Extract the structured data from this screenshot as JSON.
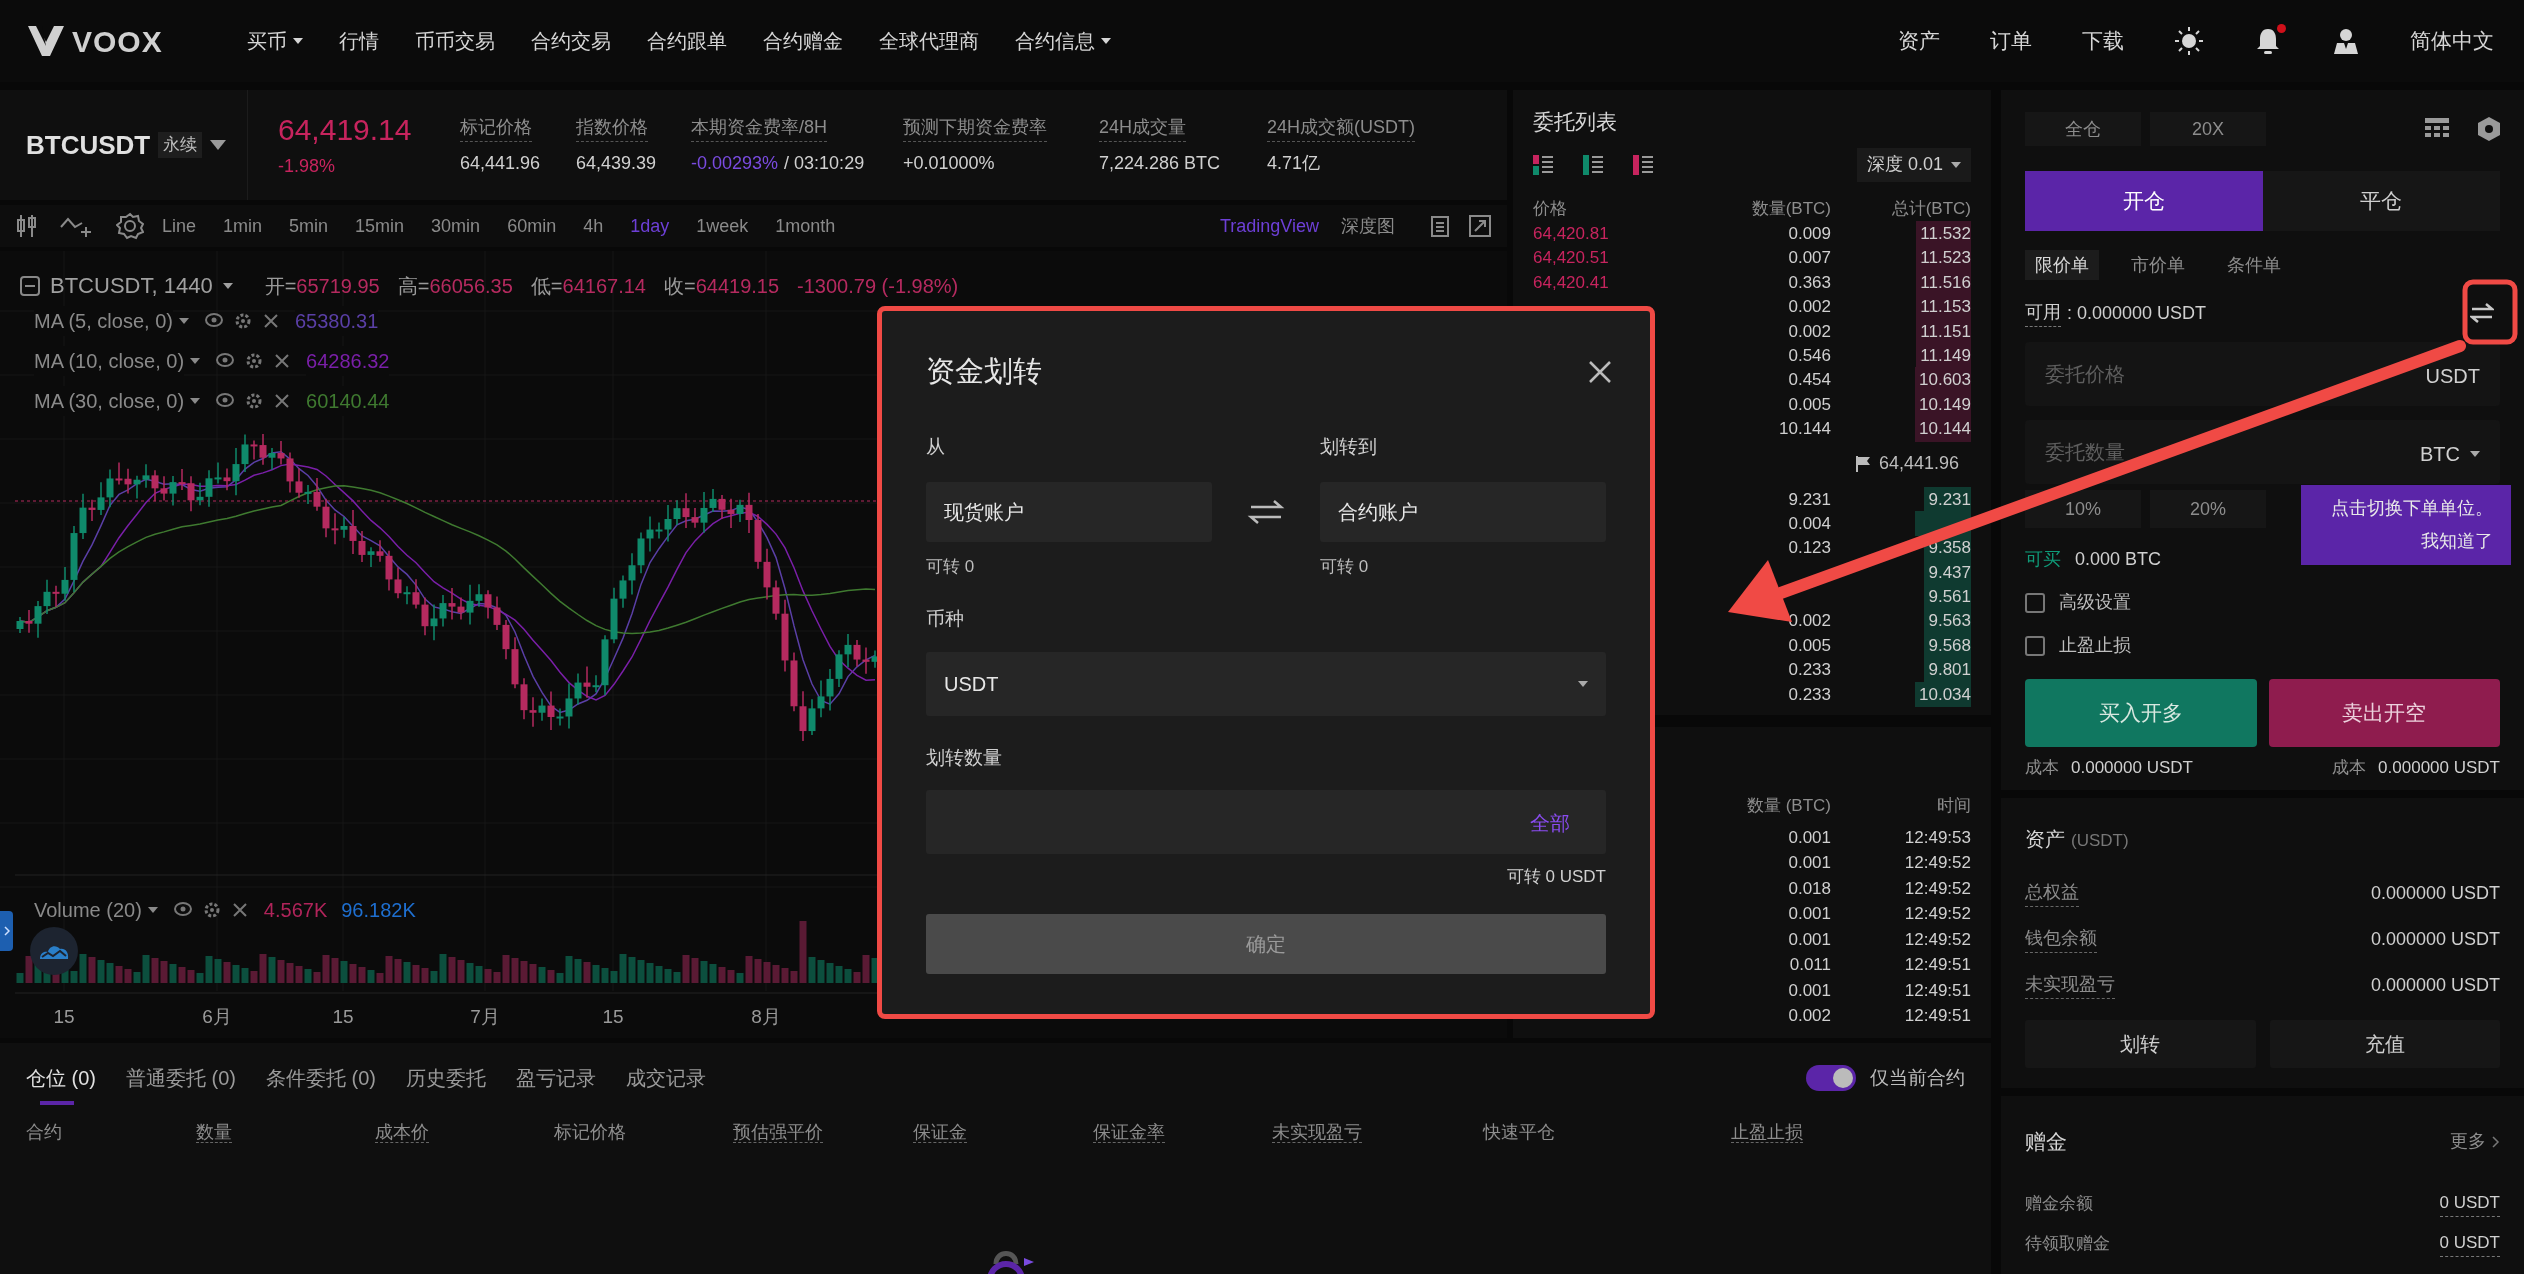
{
  "nav": {
    "logo": "VOOX",
    "items": [
      {
        "label": "买币",
        "dropdown": true
      },
      {
        "label": "行情",
        "dropdown": false
      },
      {
        "label": "币币交易",
        "dropdown": false
      },
      {
        "label": "合约交易",
        "dropdown": false
      },
      {
        "label": "合约跟单",
        "dropdown": false
      },
      {
        "label": "合约赠金",
        "dropdown": false
      },
      {
        "label": "全球代理商",
        "dropdown": false
      },
      {
        "label": "合约信息",
        "dropdown": true
      }
    ],
    "links": [
      "资产",
      "订单",
      "下载"
    ],
    "unread_notifications": true,
    "language": "简体中文"
  },
  "ticker": {
    "symbol": "BTCUSDT",
    "tag": "永续",
    "price": "64,419.14",
    "change": "-1.98%",
    "stats": [
      {
        "label": "标记价格",
        "value": "64,441.96",
        "highlight": false
      },
      {
        "label": "指数价格",
        "value": "64,439.39",
        "highlight": false
      },
      {
        "label": "本期资金费率/8H",
        "value": "-0.00293%",
        "countdown": "/ 03:10:29",
        "highlight": true
      },
      {
        "label": "预测下期资金费率",
        "value": "+0.01000%",
        "highlight": false
      },
      {
        "label": "24H成交量",
        "value": "7,224.286 BTC",
        "highlight": false
      },
      {
        "label": "24H成交额(USDT)",
        "value": "4.71亿",
        "highlight": false
      }
    ]
  },
  "chart_toolbar": {
    "style_label": "Line",
    "intervals": [
      {
        "label": "1min",
        "selected": false
      },
      {
        "label": "5min",
        "selected": false
      },
      {
        "label": "15min",
        "selected": false
      },
      {
        "label": "30min",
        "selected": false
      },
      {
        "label": "60min",
        "selected": false
      },
      {
        "label": "4h",
        "selected": false
      },
      {
        "label": "1day",
        "selected": true
      },
      {
        "label": "1week",
        "selected": false
      },
      {
        "label": "1month",
        "selected": false
      }
    ],
    "views": [
      {
        "label": "TradingView",
        "selected": true
      },
      {
        "label": "深度图",
        "selected": false
      }
    ]
  },
  "chart": {
    "title": "BTCUSDT, 1440",
    "ohlc": [
      {
        "label": "开=",
        "value": "65719.95"
      },
      {
        "label": "高=",
        "value": "66056.35"
      },
      {
        "label": "低=",
        "value": "64167.14"
      },
      {
        "label": "收=",
        "value": "64419.15"
      }
    ],
    "change": "-1300.79 (-1.98%)",
    "indicators": [
      {
        "label": "MA (5, close, 0)",
        "value": "65380.31",
        "color": "#5a3fa6"
      },
      {
        "label": "MA (10, close, 0)",
        "value": "64286.32",
        "color": "#7a1fa8"
      },
      {
        "label": "MA (30, close, 0)",
        "value": "60140.44",
        "color": "#3f7a30"
      }
    ],
    "volume": {
      "label": "Volume (20)",
      "values": [
        {
          "text": "4.567K",
          "color": "#b0245a"
        },
        {
          "text": "96.182K",
          "color": "#1e6fd0"
        }
      ]
    },
    "x_labels": [
      "15",
      "6月",
      "15",
      "7月",
      "15",
      "8月"
    ]
  },
  "order_book": {
    "title": "委托列表",
    "depth": "深度 0.01",
    "columns": [
      "价格",
      "数量(BTC)",
      "总计(BTC)"
    ],
    "asks": [
      {
        "price": "64,420.81",
        "qty": "0.009",
        "total": "11.532"
      },
      {
        "price": "64,420.51",
        "qty": "0.007",
        "total": "11.523"
      },
      {
        "price": "64,420.41",
        "qty": "0.363",
        "total": "11.516"
      },
      {
        "qty": "0.002",
        "total": "11.153"
      },
      {
        "qty": "0.002",
        "total": "11.151"
      },
      {
        "qty": "0.546",
        "total": "11.149"
      },
      {
        "qty": "0.454",
        "total": "10.603"
      },
      {
        "qty": "0.005",
        "total": "10.149"
      },
      {
        "qty": "10.144",
        "total": "10.144"
      }
    ],
    "mid_price": "64,441.96",
    "bids": [
      {
        "qty": "9.231",
        "total": "9.231"
      },
      {
        "qty": "0.004"
      },
      {
        "qty": "0.123",
        "total": "9.358"
      },
      {
        "total": "9.437"
      },
      {
        "total": "9.561"
      },
      {
        "qty": "0.002",
        "total": "9.563"
      },
      {
        "qty": "0.005",
        "total": "9.568"
      },
      {
        "qty": "0.233",
        "total": "9.801"
      },
      {
        "qty": "0.233",
        "total": "10.034"
      }
    ]
  },
  "trades": {
    "columns": [
      "数量 (BTC)",
      "时间"
    ],
    "rows": [
      {
        "qty": "0.001",
        "time": "12:49:53"
      },
      {
        "qty": "0.001",
        "time": "12:49:52"
      },
      {
        "qty": "0.018",
        "time": "12:49:52"
      },
      {
        "qty": "0.001",
        "time": "12:49:52"
      },
      {
        "qty": "0.001",
        "time": "12:49:52"
      },
      {
        "qty": "0.011",
        "time": "12:49:51"
      },
      {
        "qty": "0.001",
        "time": "12:49:51"
      },
      {
        "qty": "0.002",
        "time": "12:49:51"
      }
    ]
  },
  "order_form": {
    "margin_mode": "全仓",
    "leverage": "20X",
    "sides": [
      {
        "label": "开仓",
        "selected": true
      },
      {
        "label": "平仓",
        "selected": false
      }
    ],
    "order_types": [
      {
        "label": "限价单",
        "selected": true
      },
      {
        "label": "市价单",
        "selected": false
      },
      {
        "label": "条件单",
        "selected": false
      }
    ],
    "available": {
      "label": "可用",
      "value": ": 0.000000 USDT"
    },
    "price_field": {
      "placeholder": "委托价格",
      "unit": "USDT"
    },
    "qty_field": {
      "placeholder": "委托数量",
      "unit": "BTC"
    },
    "percents": [
      "10%",
      "20%"
    ],
    "tooltip": {
      "text": "点击切换下单单位。",
      "action": "我知道了"
    },
    "can_buy": {
      "label": "可买",
      "value": "0.000 BTC"
    },
    "options": [
      {
        "label": "高级设置",
        "checked": false
      },
      {
        "label": "止盈止损",
        "checked": false
      }
    ],
    "buy": "买入开多",
    "sell": "卖出开空",
    "costs": [
      {
        "label": "成本",
        "value": "0.000000 USDT"
      },
      {
        "label": "成本",
        "value": "0.000000 USDT"
      }
    ]
  },
  "assets": {
    "title": "资产",
    "unit": "(USDT)",
    "rows": [
      {
        "label": "总权益",
        "value": "0.000000 USDT"
      },
      {
        "label": "钱包余额",
        "value": "0.000000 USDT"
      },
      {
        "label": "未实现盈亏",
        "value": "0.000000 USDT"
      }
    ],
    "buttons": [
      "划转",
      "充值"
    ]
  },
  "bonus": {
    "title": "赠金",
    "more": "更多",
    "rows": [
      {
        "label": "赠金余额",
        "value": "0 USDT"
      },
      {
        "label": "待领取赠金",
        "value": "0 USDT"
      }
    ]
  },
  "positions": {
    "tabs": [
      {
        "label": "仓位 (0)",
        "selected": true
      },
      {
        "label": "普通委托 (0)",
        "selected": false
      },
      {
        "label": "条件委托 (0)",
        "selected": false
      },
      {
        "label": "历史委托",
        "selected": false
      },
      {
        "label": "盈亏记录",
        "selected": false
      },
      {
        "label": "成交记录",
        "selected": false
      }
    ],
    "filter": {
      "label": "仅当前合约",
      "on": true
    },
    "columns": [
      {
        "label": "合约",
        "hint": false
      },
      {
        "label": "数量",
        "hint": true
      },
      {
        "label": "成本价",
        "hint": true
      },
      {
        "label": "标记价格",
        "hint": false
      },
      {
        "label": "预估强平价",
        "hint": true
      },
      {
        "label": "保证金",
        "hint": true
      },
      {
        "label": "保证金率",
        "hint": true
      },
      {
        "label": "未实现盈亏",
        "hint": true
      },
      {
        "label": "快速平仓",
        "hint": false
      },
      {
        "label": "止盈止损",
        "hint": true
      }
    ]
  },
  "transfer_dialog": {
    "title": "资金划转",
    "from": {
      "label": "从",
      "value": "现货账户",
      "note": "可转 0"
    },
    "to": {
      "label": "划转到",
      "value": "合约账户",
      "note": "可转 0"
    },
    "coin": {
      "label": "币种",
      "value": "USDT"
    },
    "amount": {
      "label": "划转数量",
      "action": "全部",
      "note": "可转 0 USDT"
    },
    "confirm": {
      "label": "确定",
      "disabled": true
    }
  }
}
